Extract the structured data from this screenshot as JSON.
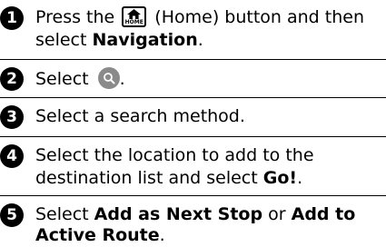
{
  "steps": [
    {
      "number": "1",
      "pre": "Press the ",
      "icon_label": "HOME",
      "mid": " (Home) button and then",
      "line2_pre": "select ",
      "line2_bold": "Navigation",
      "line2_post": "."
    },
    {
      "number": "2",
      "pre": "Select ",
      "post": "."
    },
    {
      "number": "3",
      "text": "Select a search method."
    },
    {
      "number": "4",
      "line1": "Select the location to add to the",
      "line2_pre": "destination list and select ",
      "line2_bold": "Go!",
      "line2_post": "."
    },
    {
      "number": "5",
      "pre": "Select ",
      "bold1": "Add as Next Stop",
      "mid": " or ",
      "bold2": "Add to",
      "line2_bold": "Active Route",
      "line2_post": "."
    }
  ],
  "icons": {
    "home": "home-icon",
    "search": "magnifier-icon"
  },
  "colors": {
    "badge": "#000000",
    "search_button": "#8a8a8a",
    "rule": "#000000"
  }
}
